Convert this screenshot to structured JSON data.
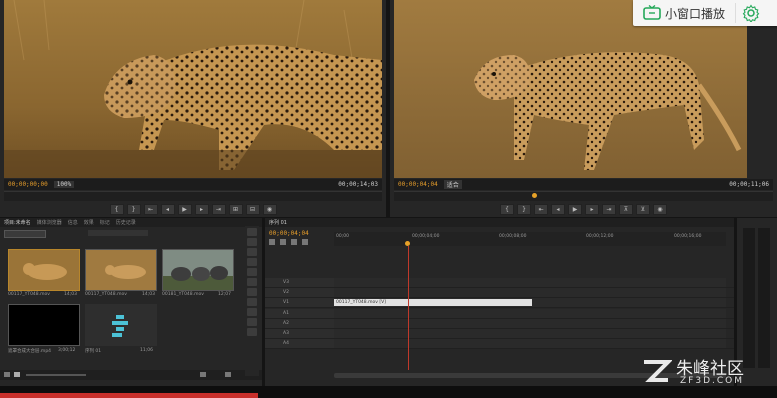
{
  "source_monitor": {
    "timecode_current": "00;00;00;00",
    "fit_label": "100%",
    "timecode_duration": "00;00;14;03"
  },
  "program_monitor": {
    "timecode_current": "00;00;04;04",
    "fit_label": "适合",
    "timecode_duration": "00;00;11;06"
  },
  "floating_window_badge": {
    "label": "小窗口播放",
    "icon": "tv-icon",
    "settings_icon": "gear-icon",
    "accent": "#25a85a"
  },
  "project_panel": {
    "tabs": [
      "项目:未命名",
      "媒体浏览器",
      "信息",
      "效果",
      "标记",
      "历史记录"
    ],
    "search_value": "",
    "items": [
      {
        "name": "00117_YT048.mov",
        "duration": "14;03"
      },
      {
        "name": "00117_YT048.mov",
        "duration": "14;03"
      },
      {
        "name": "00181_YT048.mov",
        "duration": "12;07"
      },
      {
        "name": "遮罩合成大合层.mp4",
        "duration": "3;00;12"
      },
      {
        "name": "序列 01",
        "duration": "11;06"
      }
    ]
  },
  "timeline": {
    "tab": "序列 01",
    "timecode": "00;00;04;04",
    "ruler_labels": [
      "00;00",
      "00;00;04;00",
      "00;00;08;00",
      "00;00;12;00",
      "00;00;16;00"
    ],
    "tracks": [
      "V3",
      "V2",
      "V1",
      "A1",
      "A2",
      "A3",
      "A4"
    ],
    "clip_label": "00117_YT048.mov [V]"
  },
  "watermark": {
    "text": "朱峰社区",
    "subtext": "ZF3D.COM"
  }
}
